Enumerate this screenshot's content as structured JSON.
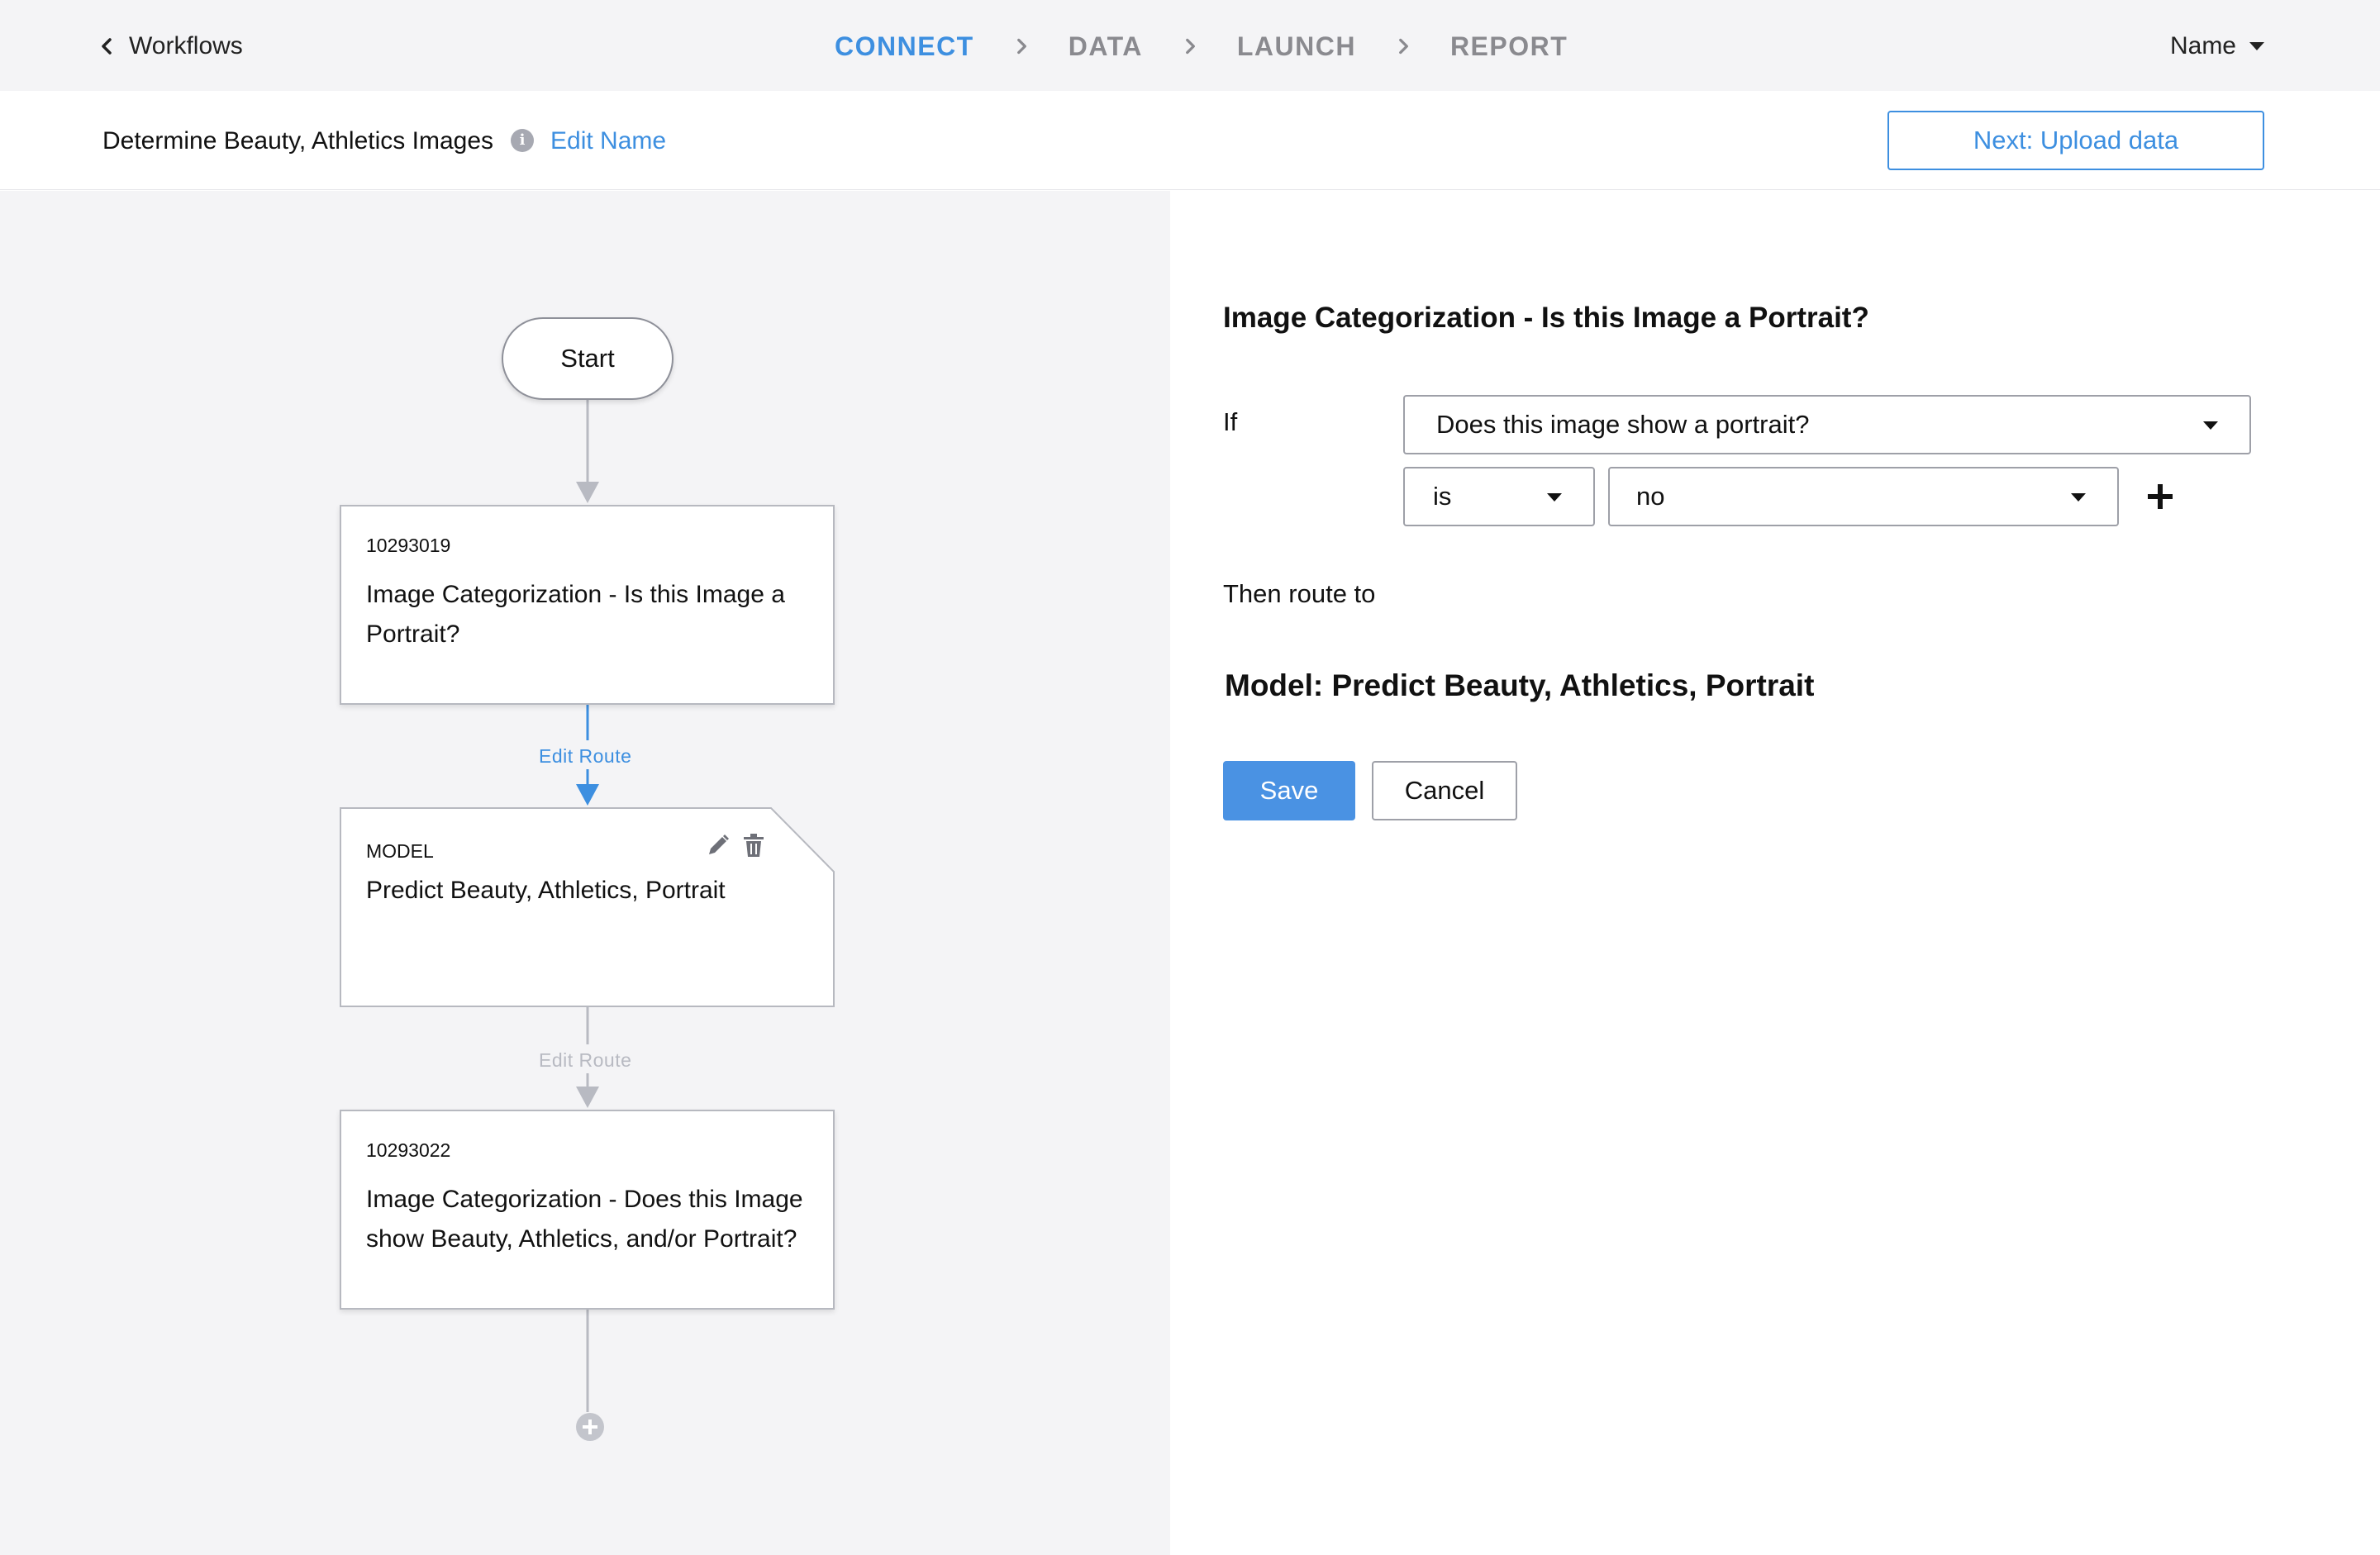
{
  "topbar": {
    "back_label": "Workflows",
    "steps": [
      {
        "label": "CONNECT",
        "active": true
      },
      {
        "label": "DATA",
        "active": false
      },
      {
        "label": "LAUNCH",
        "active": false
      },
      {
        "label": "REPORT",
        "active": false
      }
    ],
    "user_menu_label": "Name"
  },
  "subheader": {
    "workflow_title": "Determine Beauty, Athletics Images",
    "info_icon_glyph": "i",
    "edit_name_label": "Edit Name",
    "next_button_label": "Next: Upload data"
  },
  "flow": {
    "start_label": "Start",
    "node1": {
      "id": "10293019",
      "title": "Image Categorization - Is this Image a Portrait?"
    },
    "route1_label": "Edit Route",
    "model_node": {
      "type_label": "MODEL",
      "title": "Predict Beauty, Athletics, Portrait"
    },
    "route2_label": "Edit Route",
    "node3": {
      "id": "10293022",
      "title": "Image Categorization - Does this Image show Beauty, Athletics, and/or Portrait?"
    }
  },
  "panel": {
    "title": "Image Categorization - Is this Image a Portrait?",
    "if_label": "If",
    "question_value": "Does this image show a portrait?",
    "operator_value": "is",
    "answer_value": "no",
    "then_label": "Then route to",
    "route_target": "Model: Predict Beauty, Athletics, Portrait",
    "save_label": "Save",
    "cancel_label": "Cancel"
  },
  "colors": {
    "accent": "#3d8fe0",
    "save_button": "#4a92e3",
    "canvas_bg": "#f4f4f6",
    "connector": "#b8bac2"
  },
  "icons": [
    "chevron-left-icon",
    "chevron-right-icon",
    "caret-down-icon",
    "info-icon",
    "pencil-icon",
    "trash-icon",
    "plus-icon",
    "add-circle-icon"
  ]
}
